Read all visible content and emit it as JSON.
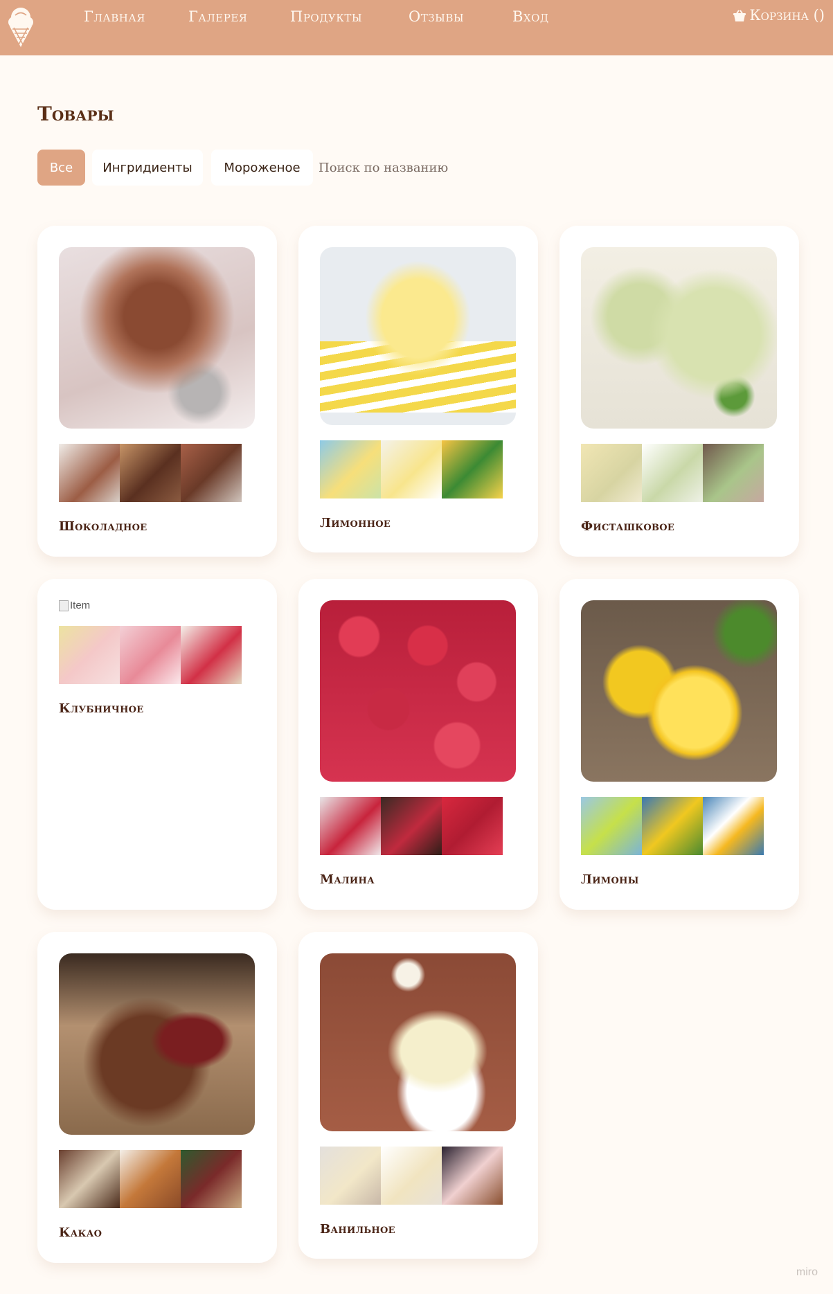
{
  "nav": {
    "links": [
      "Главная",
      "Галерея",
      "Продукты",
      "Отзывы",
      "Вход"
    ],
    "cart_label": "Корзина ()"
  },
  "page": {
    "title": "Товары"
  },
  "filters": {
    "items": [
      "Все",
      "Ингридиенты",
      "Мороженое"
    ],
    "active": "Все",
    "search_placeholder": "Поиск по названию",
    "search_value": ""
  },
  "colors": {
    "accent": "#dfa584",
    "background": "#fffaf5",
    "card": "#ffffff",
    "text_dark": "#4a2416"
  },
  "products": [
    {
      "name": "Шоколадное"
    },
    {
      "name": "Лимонное"
    },
    {
      "name": "Фисташковое"
    },
    {
      "name": "Клубничное",
      "image_alt": "Item"
    },
    {
      "name": "Малина"
    },
    {
      "name": "Лимоны"
    },
    {
      "name": "Какао"
    },
    {
      "name": "Ванильное"
    }
  ],
  "watermark": "miro"
}
